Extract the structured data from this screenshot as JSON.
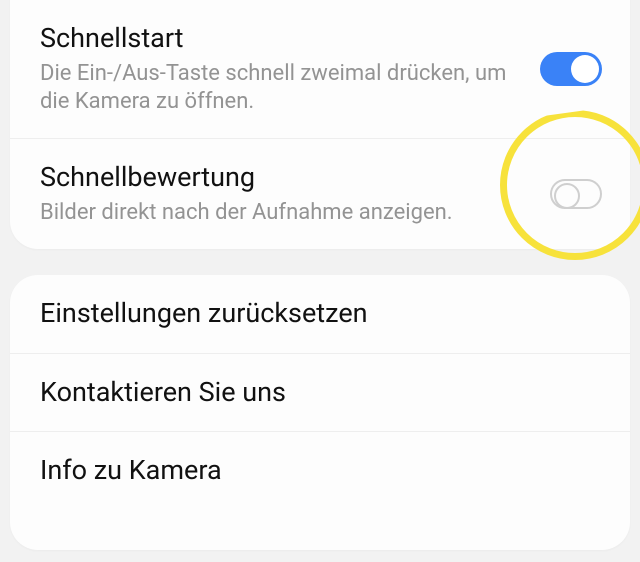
{
  "section1": {
    "items": [
      {
        "title": "Schnellstart",
        "subtitle": "Die Ein-/Aus-Taste schnell zweimal drücken, um die Kamera zu öffnen.",
        "toggle": true
      },
      {
        "title": "Schnellbewertung",
        "subtitle": "Bilder direkt nach der Aufnahme anzeigen.",
        "toggle": false
      }
    ]
  },
  "section2": {
    "items": [
      {
        "title": "Einstellungen zurücksetzen"
      },
      {
        "title": "Kontaktieren Sie uns"
      },
      {
        "title": "Info zu Kamera"
      }
    ]
  }
}
